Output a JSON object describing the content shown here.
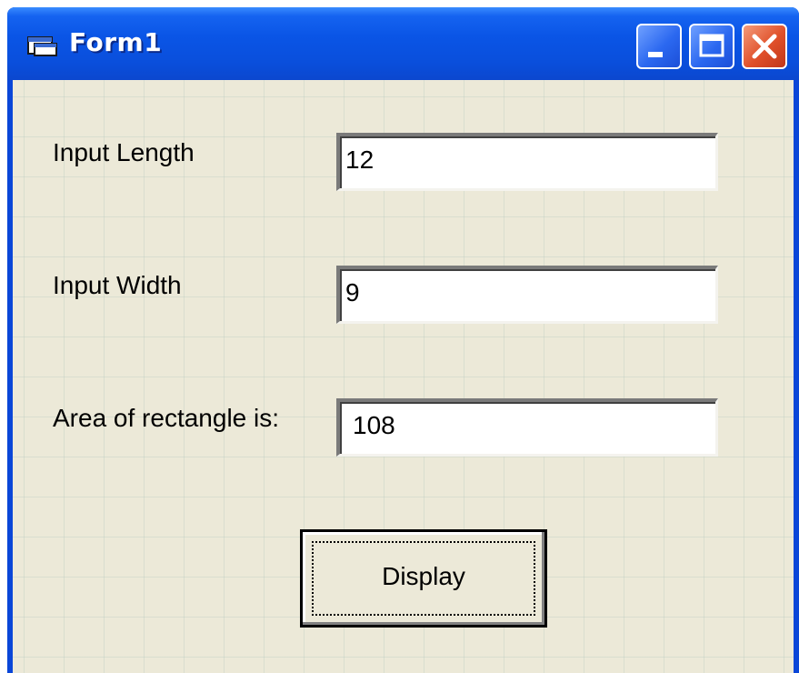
{
  "window": {
    "title": "Form1",
    "controls": [
      "minimize-icon",
      "maximize-icon",
      "close-icon"
    ]
  },
  "form": {
    "length_label": "Input Length",
    "length_value": "12",
    "width_label": "Input Width",
    "width_value": "9",
    "area_label": "Area of rectangle is:",
    "area_value": "108",
    "display_button": "Display"
  },
  "colors": {
    "titlebar": "#0a55e6",
    "client_background": "#ece9d8",
    "close_button": "#e0502a"
  }
}
